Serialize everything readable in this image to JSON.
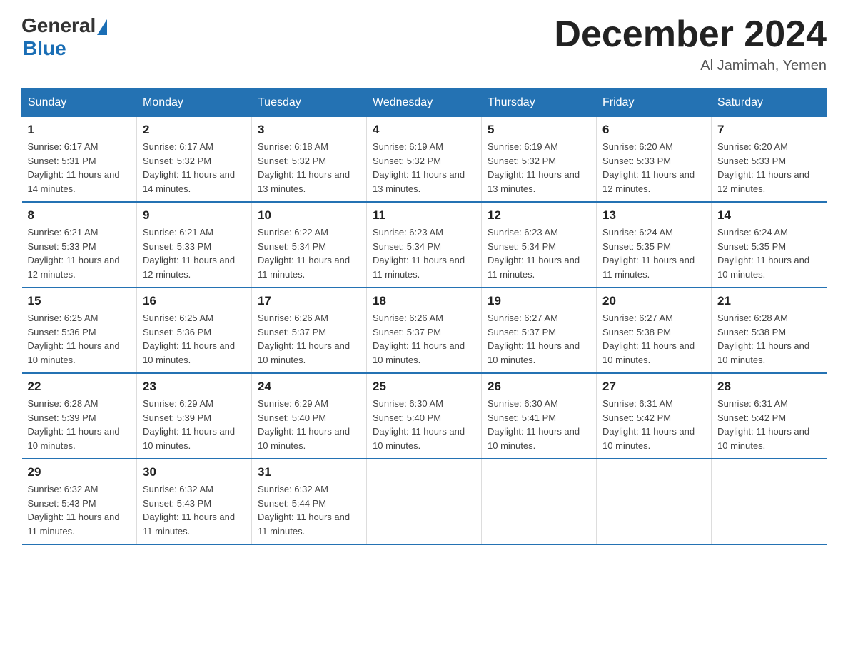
{
  "logo": {
    "general": "General",
    "blue": "Blue",
    "subtitle": "Blue"
  },
  "header": {
    "month": "December 2024",
    "location": "Al Jamimah, Yemen"
  },
  "days_of_week": [
    "Sunday",
    "Monday",
    "Tuesday",
    "Wednesday",
    "Thursday",
    "Friday",
    "Saturday"
  ],
  "weeks": [
    [
      {
        "day": "1",
        "sunrise": "6:17 AM",
        "sunset": "5:31 PM",
        "daylight": "11 hours and 14 minutes."
      },
      {
        "day": "2",
        "sunrise": "6:17 AM",
        "sunset": "5:32 PM",
        "daylight": "11 hours and 14 minutes."
      },
      {
        "day": "3",
        "sunrise": "6:18 AM",
        "sunset": "5:32 PM",
        "daylight": "11 hours and 13 minutes."
      },
      {
        "day": "4",
        "sunrise": "6:19 AM",
        "sunset": "5:32 PM",
        "daylight": "11 hours and 13 minutes."
      },
      {
        "day": "5",
        "sunrise": "6:19 AM",
        "sunset": "5:32 PM",
        "daylight": "11 hours and 13 minutes."
      },
      {
        "day": "6",
        "sunrise": "6:20 AM",
        "sunset": "5:33 PM",
        "daylight": "11 hours and 12 minutes."
      },
      {
        "day": "7",
        "sunrise": "6:20 AM",
        "sunset": "5:33 PM",
        "daylight": "11 hours and 12 minutes."
      }
    ],
    [
      {
        "day": "8",
        "sunrise": "6:21 AM",
        "sunset": "5:33 PM",
        "daylight": "11 hours and 12 minutes."
      },
      {
        "day": "9",
        "sunrise": "6:21 AM",
        "sunset": "5:33 PM",
        "daylight": "11 hours and 12 minutes."
      },
      {
        "day": "10",
        "sunrise": "6:22 AM",
        "sunset": "5:34 PM",
        "daylight": "11 hours and 11 minutes."
      },
      {
        "day": "11",
        "sunrise": "6:23 AM",
        "sunset": "5:34 PM",
        "daylight": "11 hours and 11 minutes."
      },
      {
        "day": "12",
        "sunrise": "6:23 AM",
        "sunset": "5:34 PM",
        "daylight": "11 hours and 11 minutes."
      },
      {
        "day": "13",
        "sunrise": "6:24 AM",
        "sunset": "5:35 PM",
        "daylight": "11 hours and 11 minutes."
      },
      {
        "day": "14",
        "sunrise": "6:24 AM",
        "sunset": "5:35 PM",
        "daylight": "11 hours and 10 minutes."
      }
    ],
    [
      {
        "day": "15",
        "sunrise": "6:25 AM",
        "sunset": "5:36 PM",
        "daylight": "11 hours and 10 minutes."
      },
      {
        "day": "16",
        "sunrise": "6:25 AM",
        "sunset": "5:36 PM",
        "daylight": "11 hours and 10 minutes."
      },
      {
        "day": "17",
        "sunrise": "6:26 AM",
        "sunset": "5:37 PM",
        "daylight": "11 hours and 10 minutes."
      },
      {
        "day": "18",
        "sunrise": "6:26 AM",
        "sunset": "5:37 PM",
        "daylight": "11 hours and 10 minutes."
      },
      {
        "day": "19",
        "sunrise": "6:27 AM",
        "sunset": "5:37 PM",
        "daylight": "11 hours and 10 minutes."
      },
      {
        "day": "20",
        "sunrise": "6:27 AM",
        "sunset": "5:38 PM",
        "daylight": "11 hours and 10 minutes."
      },
      {
        "day": "21",
        "sunrise": "6:28 AM",
        "sunset": "5:38 PM",
        "daylight": "11 hours and 10 minutes."
      }
    ],
    [
      {
        "day": "22",
        "sunrise": "6:28 AM",
        "sunset": "5:39 PM",
        "daylight": "11 hours and 10 minutes."
      },
      {
        "day": "23",
        "sunrise": "6:29 AM",
        "sunset": "5:39 PM",
        "daylight": "11 hours and 10 minutes."
      },
      {
        "day": "24",
        "sunrise": "6:29 AM",
        "sunset": "5:40 PM",
        "daylight": "11 hours and 10 minutes."
      },
      {
        "day": "25",
        "sunrise": "6:30 AM",
        "sunset": "5:40 PM",
        "daylight": "11 hours and 10 minutes."
      },
      {
        "day": "26",
        "sunrise": "6:30 AM",
        "sunset": "5:41 PM",
        "daylight": "11 hours and 10 minutes."
      },
      {
        "day": "27",
        "sunrise": "6:31 AM",
        "sunset": "5:42 PM",
        "daylight": "11 hours and 10 minutes."
      },
      {
        "day": "28",
        "sunrise": "6:31 AM",
        "sunset": "5:42 PM",
        "daylight": "11 hours and 10 minutes."
      }
    ],
    [
      {
        "day": "29",
        "sunrise": "6:32 AM",
        "sunset": "5:43 PM",
        "daylight": "11 hours and 11 minutes."
      },
      {
        "day": "30",
        "sunrise": "6:32 AM",
        "sunset": "5:43 PM",
        "daylight": "11 hours and 11 minutes."
      },
      {
        "day": "31",
        "sunrise": "6:32 AM",
        "sunset": "5:44 PM",
        "daylight": "11 hours and 11 minutes."
      },
      null,
      null,
      null,
      null
    ]
  ]
}
